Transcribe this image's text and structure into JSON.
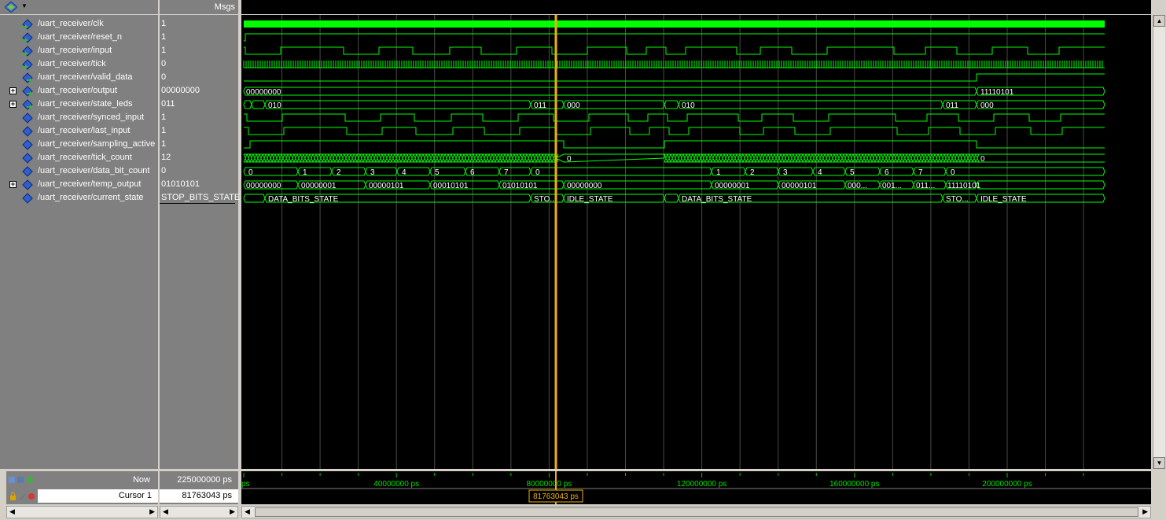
{
  "header": {
    "msgs_label": "Msgs"
  },
  "signals": [
    {
      "name": "/uart_receiver/clk",
      "value": "1",
      "expandable": false,
      "kind": "input"
    },
    {
      "name": "/uart_receiver/reset_n",
      "value": "1",
      "expandable": false,
      "kind": "input"
    },
    {
      "name": "/uart_receiver/input",
      "value": "1",
      "expandable": false,
      "kind": "input"
    },
    {
      "name": "/uart_receiver/tick",
      "value": "0",
      "expandable": false,
      "kind": "input"
    },
    {
      "name": "/uart_receiver/valid_data",
      "value": "0",
      "expandable": false,
      "kind": "output"
    },
    {
      "name": "/uart_receiver/output",
      "value": "00000000",
      "expandable": true,
      "kind": "output"
    },
    {
      "name": "/uart_receiver/state_leds",
      "value": "011",
      "expandable": true,
      "kind": "output"
    },
    {
      "name": "/uart_receiver/synced_input",
      "value": "1",
      "expandable": false,
      "kind": "internal"
    },
    {
      "name": "/uart_receiver/last_input",
      "value": "1",
      "expandable": false,
      "kind": "internal"
    },
    {
      "name": "/uart_receiver/sampling_active",
      "value": "1",
      "expandable": false,
      "kind": "internal"
    },
    {
      "name": "/uart_receiver/tick_count",
      "value": "12",
      "expandable": false,
      "kind": "internal"
    },
    {
      "name": "/uart_receiver/data_bit_count",
      "value": "0",
      "expandable": false,
      "kind": "internal"
    },
    {
      "name": "/uart_receiver/temp_output",
      "value": "01010101",
      "expandable": true,
      "kind": "internal"
    },
    {
      "name": "/uart_receiver/current_state",
      "value": "STOP_BITS_STATE",
      "expandable": false,
      "kind": "internal"
    }
  ],
  "bus_labels": {
    "output": [
      "00000000",
      "11110101"
    ],
    "state_leds": [
      "010",
      "011",
      "000",
      "010",
      "011",
      "000"
    ],
    "tick_count": [
      "0"
    ],
    "data_bit_count": [
      "0",
      "1",
      "2",
      "3",
      "4",
      "5",
      "6",
      "7",
      "0",
      "1",
      "2",
      "3",
      "4",
      "5",
      "6",
      "7",
      "0"
    ],
    "temp_output": [
      "00000000",
      "00000001",
      "00000101",
      "00010101",
      "01010101",
      "00000000",
      "00000001",
      "00000101",
      "000...",
      "001...",
      "011...",
      "11110101"
    ],
    "current_state": [
      "DATA_BITS_STATE",
      "STO...",
      "IDLE_STATE",
      "DATA_BITS_STATE",
      "STO...",
      "IDLE_STATE"
    ]
  },
  "bottom": {
    "now_label": "Now",
    "now_value": "225000000 ps",
    "cursor_label": "Cursor 1",
    "cursor_value": "81763043 ps",
    "cursor_flag": "81763043 ps"
  },
  "timeline": {
    "ticks": [
      "ps",
      "40000000 ps",
      "80000000 ps",
      "120000000 ps",
      "160000000 ps",
      "200000000 ps"
    ]
  },
  "colors": {
    "wave": "#00ff00",
    "cursor": "#f0b000",
    "grid": "#4a4a4a",
    "bus_text": "#ffffff"
  }
}
